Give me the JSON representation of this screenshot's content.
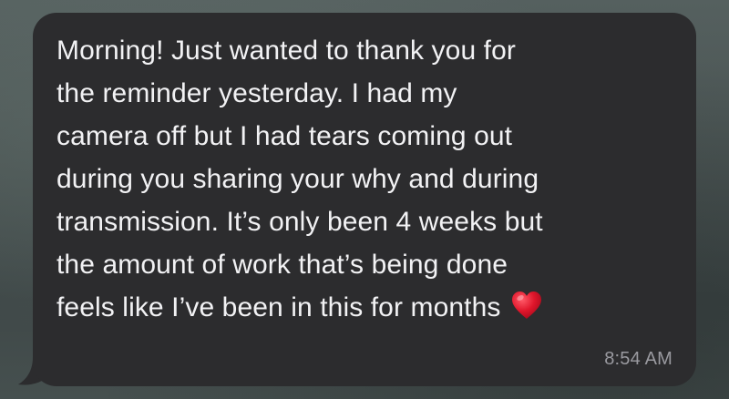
{
  "message": {
    "lines": [
      "Morning! Just wanted to thank you for",
      "the reminder yesterday. I had my",
      "camera off but I had tears coming out",
      "during you sharing your why and during",
      "transmission. It’s only been 4 weeks but",
      "the amount of work that’s being done",
      "feels like I’ve been in this for months"
    ],
    "emoji": "red-heart",
    "timestamp": "8:54 AM"
  },
  "colors": {
    "bubble": "#2c2c2e",
    "text": "#f2f2f4",
    "timestamp": "#9a9aa0",
    "heart": "#e0162b"
  }
}
